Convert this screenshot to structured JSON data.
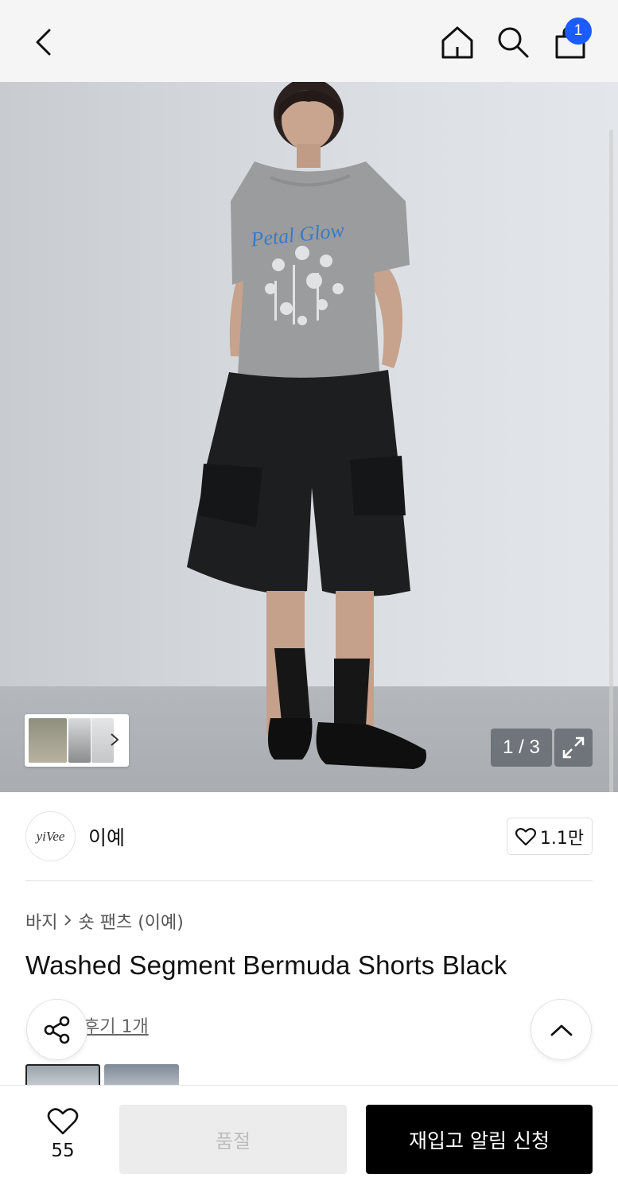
{
  "header": {
    "cart_count": "1"
  },
  "gallery": {
    "counter": "1 / 3"
  },
  "brand": {
    "logo_text": "yiVee",
    "name": "이예",
    "likes": "1.1만"
  },
  "breadcrumb": {
    "category": "바지",
    "sub_category": "숏 팬츠 (이예)"
  },
  "product": {
    "title": "Washed Segment Bermuda Shorts Black",
    "review_link": "후기 1개"
  },
  "bottom_bar": {
    "wish_count": "55",
    "sold_out_label": "품절",
    "restock_label": "재입고 알림 신청"
  },
  "colors": {
    "badge": "#1a5cff",
    "primary_button": "#000000",
    "disabled_button": "#ececec"
  }
}
